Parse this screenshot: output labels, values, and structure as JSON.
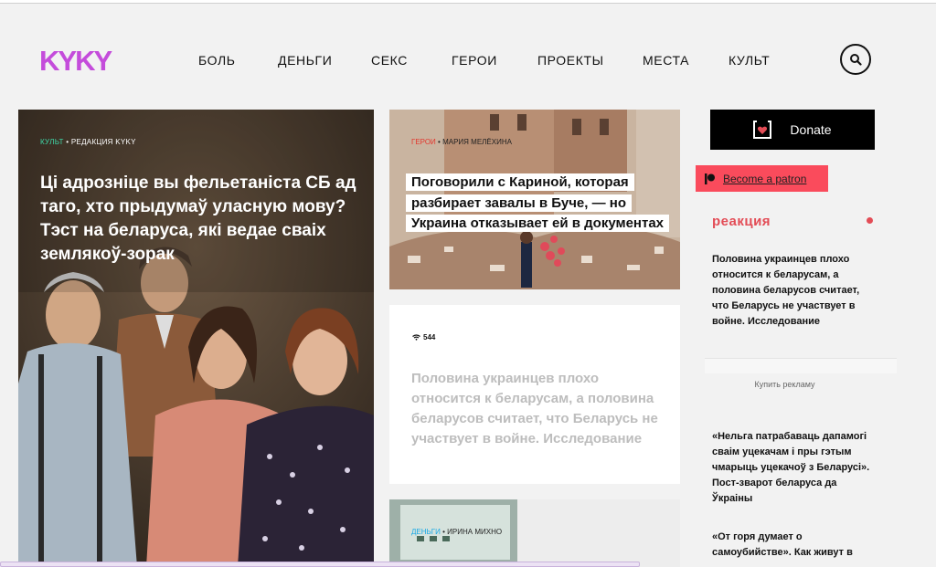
{
  "brand": {
    "name": "KYKY",
    "color": "#c44cdb"
  },
  "nav": {
    "items": [
      "БОЛЬ",
      "ДЕНЬГИ",
      "СЕКС",
      "ГЕРОИ",
      "ПРОЕКТЫ",
      "МЕСТА",
      "КУЛЬТ"
    ]
  },
  "search": {
    "icon": "search-icon"
  },
  "main_story": {
    "category": "КУЛЬТ",
    "author": "РЕДАКЦИЯ KYKY",
    "title": "Ці адрозніце вы фельетаніста СБ ад таго, хто прыдумаў уласную мову? Тэст на беларуса, які ведае сваіх землякоў-зорак"
  },
  "top_story": {
    "category": "ГЕРОИ",
    "author": "МАРИЯ МЕЛЁХИНА",
    "title": "Поговорили с Кариной, которая разбирает завалы в Буче, — но Украина отказывает ей в документах"
  },
  "mid_story": {
    "views": "544",
    "title": "Половина украинцев плохо относится к беларусам, а половина беларусов считает, что Беларусь не участвует в войне. Исследование"
  },
  "bottom_story": {
    "category": "ДЕНЬГИ",
    "author": "ИРИНА МИХНО"
  },
  "sidebar": {
    "donate_label": "Donate",
    "patron_label": "Become a patron",
    "reaction_title": "реакция",
    "reaction_items": [
      "Половина украинцев плохо относится к беларусам, а половина беларусов считает, что Беларусь не участвует в войне. Исследование",
      "«Нельга патрабаваць дапамогі сваім уцекачам і пры гэтым чмарыць уцекачоў з Беларусі». Пост-зварот беларуса да Ўкраіны",
      "«От горя думает о самоубийстве». Как живут в"
    ],
    "buy_ad_label": "Купить рекламу"
  },
  "colors": {
    "accent_red": "#e34c56",
    "patreon": "#fa4b5c",
    "kult_green": "#3fd7a8",
    "geroi_red": "#e3352c",
    "dengi_blue": "#19a9e6"
  }
}
